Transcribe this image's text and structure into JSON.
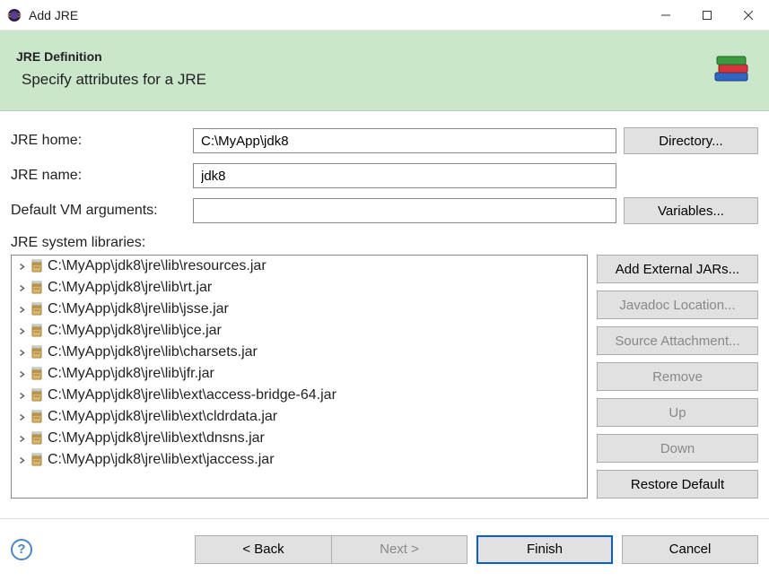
{
  "window": {
    "title": "Add JRE"
  },
  "banner": {
    "title": "JRE Definition",
    "subtitle": "Specify attributes for a JRE"
  },
  "form": {
    "jre_home_label": "JRE home:",
    "jre_home_value": "C:\\MyApp\\jdk8",
    "directory_btn": "Directory...",
    "jre_name_label": "JRE name:",
    "jre_name_value": "jdk8",
    "vm_args_label": "Default VM arguments:",
    "vm_args_value": "",
    "variables_btn": "Variables..."
  },
  "libs": {
    "label": "JRE system libraries:",
    "items": [
      "C:\\MyApp\\jdk8\\jre\\lib\\resources.jar",
      "C:\\MyApp\\jdk8\\jre\\lib\\rt.jar",
      "C:\\MyApp\\jdk8\\jre\\lib\\jsse.jar",
      "C:\\MyApp\\jdk8\\jre\\lib\\jce.jar",
      "C:\\MyApp\\jdk8\\jre\\lib\\charsets.jar",
      "C:\\MyApp\\jdk8\\jre\\lib\\jfr.jar",
      "C:\\MyApp\\jdk8\\jre\\lib\\ext\\access-bridge-64.jar",
      "C:\\MyApp\\jdk8\\jre\\lib\\ext\\cldrdata.jar",
      "C:\\MyApp\\jdk8\\jre\\lib\\ext\\dnsns.jar",
      "C:\\MyApp\\jdk8\\jre\\lib\\ext\\jaccess.jar"
    ],
    "buttons": {
      "add_external": "Add External JARs...",
      "javadoc": "Javadoc Location...",
      "source": "Source Attachment...",
      "remove": "Remove",
      "up": "Up",
      "down": "Down",
      "restore": "Restore Default"
    }
  },
  "wizard": {
    "back": "< Back",
    "next": "Next >",
    "finish": "Finish",
    "cancel": "Cancel"
  }
}
